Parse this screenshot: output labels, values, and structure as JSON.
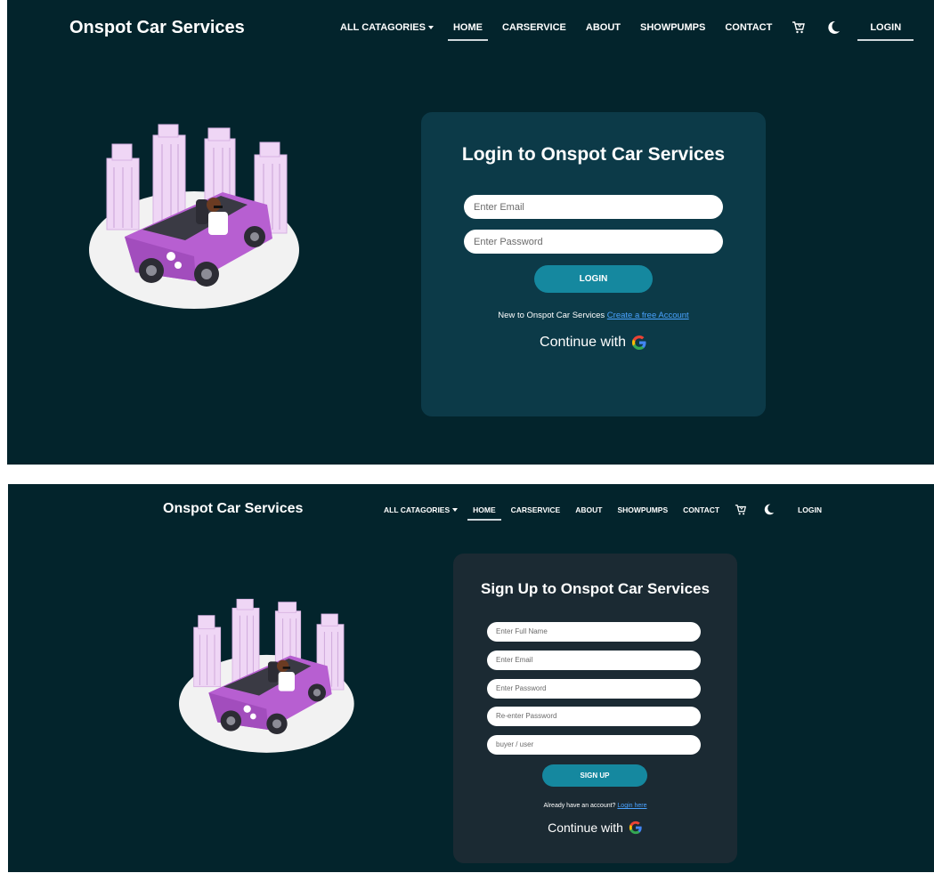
{
  "login_page": {
    "navbar": {
      "brand": "Onspot Car Services",
      "items": [
        {
          "label": "ALL CATAGORIES"
        },
        {
          "label": "HOME"
        },
        {
          "label": "CARSERVICE"
        },
        {
          "label": "ABOUT"
        },
        {
          "label": "SHOWPUMPS"
        },
        {
          "label": "CONTACT"
        }
      ],
      "login_label": "LOGIN"
    },
    "card": {
      "title": "Login to Onspot Car Services",
      "email_placeholder": "Enter Email",
      "password_placeholder": "Enter Password",
      "button_label": "LOGIN",
      "hint_text": "New to Onspot Car Services",
      "hint_link": "Create a free Account",
      "continue_text": "Continue with"
    }
  },
  "signup_page": {
    "navbar": {
      "brand": "Onspot Car Services",
      "items": [
        {
          "label": "ALL CATAGORIES"
        },
        {
          "label": "HOME"
        },
        {
          "label": "CARSERVICE"
        },
        {
          "label": "ABOUT"
        },
        {
          "label": "SHOWPUMPS"
        },
        {
          "label": "CONTACT"
        }
      ],
      "login_label": "LOGIN"
    },
    "card": {
      "title": "Sign Up to Onspot Car Services",
      "fullname_placeholder": "Enter Full Name",
      "email_placeholder": "Enter Email",
      "password_placeholder": "Enter Password",
      "reenter_placeholder": "Re-enter Password",
      "role_placeholder": "buyer / user",
      "button_label": "SIGN UP",
      "hint_text": "Already have an account?",
      "hint_link": "Login here",
      "continue_text": "Continue with"
    }
  },
  "colors": {
    "background": "#03242c",
    "login_card": "#0c3a48",
    "signup_card": "#1b2a33",
    "button": "#15889f",
    "link": "#4aa3ff",
    "car": "#b75fd1"
  },
  "icons": [
    "cart-icon",
    "moon-icon",
    "google-icon",
    "car-illustration"
  ]
}
